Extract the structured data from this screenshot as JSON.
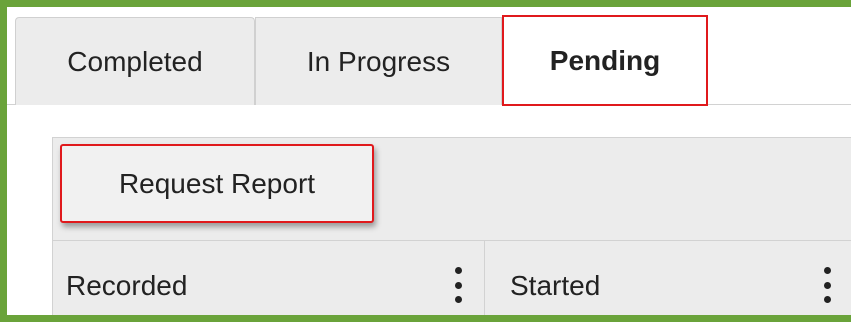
{
  "tabs": [
    {
      "label": "Completed"
    },
    {
      "label": "In Progress"
    },
    {
      "label": "Pending",
      "active": true
    }
  ],
  "toolbar": {
    "request_report_label": "Request Report"
  },
  "table": {
    "columns": [
      {
        "label": "Recorded"
      },
      {
        "label": "Started"
      }
    ]
  },
  "colors": {
    "frame_border": "#6aa33a",
    "highlight_border": "#e0191c",
    "tab_bg": "#ececec"
  },
  "icons": {
    "column_menu": "kebab-vertical-icon"
  }
}
